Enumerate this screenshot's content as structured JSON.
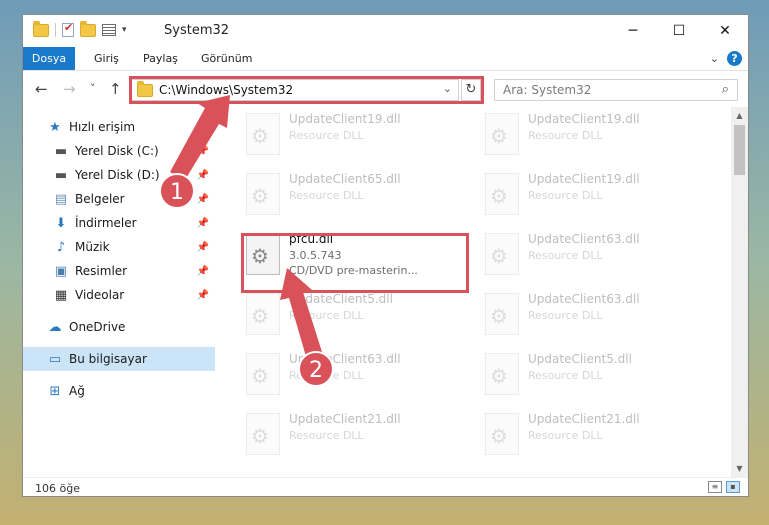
{
  "window": {
    "title": "System32"
  },
  "controls": {
    "minimize": "─",
    "maximize": "☐",
    "close": "✕"
  },
  "ribbon": {
    "tabs": [
      "Dosya",
      "Giriş",
      "Paylaş",
      "Görünüm"
    ]
  },
  "nav": {
    "back": "←",
    "forward": "→",
    "recent": "˅",
    "up": "↑",
    "address": "C:\\Windows\\System32",
    "refresh": "↻",
    "search_placeholder": "Ara: System32"
  },
  "sidebar": {
    "items": [
      {
        "label": "Hızlı erişim",
        "icon": "star-icon",
        "glyph": "★"
      },
      {
        "label": "Yerel Disk (C:)",
        "icon": "drive-icon",
        "glyph": "▬",
        "pinned": true
      },
      {
        "label": "Yerel Disk (D:)",
        "icon": "drive-icon",
        "glyph": "▬",
        "pinned": true
      },
      {
        "label": "Belgeler",
        "icon": "documents-icon",
        "glyph": "▤",
        "pinned": true
      },
      {
        "label": "İndirmeler",
        "icon": "download-icon",
        "glyph": "⬇",
        "pinned": true
      },
      {
        "label": "Müzik",
        "icon": "music-icon",
        "glyph": "♪",
        "pinned": true
      },
      {
        "label": "Resimler",
        "icon": "pictures-icon",
        "glyph": "▣",
        "pinned": true
      },
      {
        "label": "Videolar",
        "icon": "video-icon",
        "glyph": "▦",
        "pinned": true
      },
      {
        "label": "OneDrive",
        "icon": "cloud-icon",
        "glyph": "☁"
      },
      {
        "label": "Bu bilgisayar",
        "icon": "computer-icon",
        "glyph": "▭",
        "selected": true
      },
      {
        "label": "Ağ",
        "icon": "network-icon",
        "glyph": "⊞"
      }
    ]
  },
  "files": [
    {
      "name": "UpdateClient19.dll",
      "desc": "Resource DLL"
    },
    {
      "name": "UpdateClient19.dll",
      "desc": "Resource DLL"
    },
    {
      "name": "UpdateClient65.dll",
      "desc": "Resource DLL"
    },
    {
      "name": "UpdateClient19.dll",
      "desc": "Resource DLL"
    },
    {
      "name": "pfcu.dll",
      "desc": "3.0.5.743",
      "desc2": "CD/DVD pre-masterin...",
      "highlight": true
    },
    {
      "name": "UpdateClient63.dll",
      "desc": "Resource DLL"
    },
    {
      "name": "UpdateClient5.dll",
      "desc": "Resource DLL"
    },
    {
      "name": "UpdateClient63.dll",
      "desc": "Resource DLL"
    },
    {
      "name": "UpdateClient63.dll",
      "desc": "Resource DLL"
    },
    {
      "name": "UpdateClient5.dll",
      "desc": "Resource DLL"
    },
    {
      "name": "UpdateClient21.dll",
      "desc": "Resource DLL"
    },
    {
      "name": "UpdateClient21.dll",
      "desc": "Resource DLL"
    }
  ],
  "status": {
    "count": "106 öğe"
  },
  "annotations": {
    "step1": "1",
    "step2": "2",
    "color": "#d9525a"
  }
}
